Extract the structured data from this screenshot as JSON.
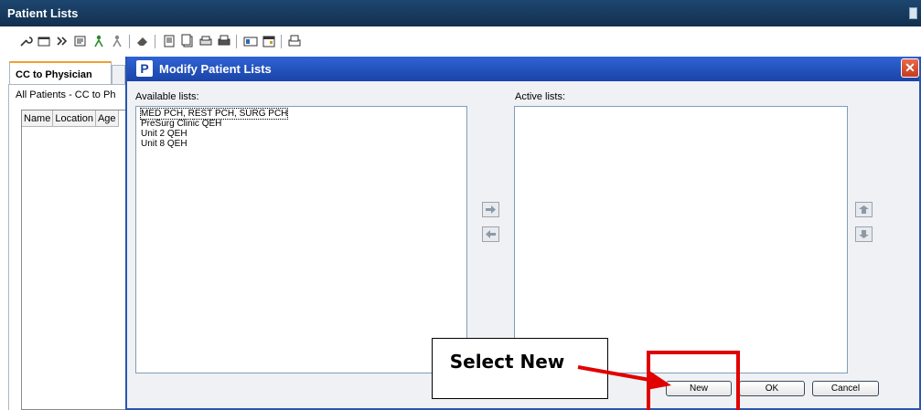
{
  "app": {
    "title": "Patient Lists"
  },
  "toolbar": {
    "icons": [
      "wrench-icon",
      "properties-icon",
      "forward-icon",
      "list-icon",
      "person-add-icon",
      "person-remove-icon",
      "eraser-icon",
      "document-icon",
      "document-copy-icon",
      "print-preview-icon",
      "print-multi-icon",
      "card-icon",
      "calendar-icon",
      "print-icon"
    ]
  },
  "left_panel": {
    "tab_label": "CC to Physician",
    "list_name": "All Patients - CC to Ph",
    "columns": [
      "Name",
      "Location",
      "Age"
    ]
  },
  "dialog": {
    "title": "Modify Patient Lists",
    "title_icon": "P",
    "close": "✕",
    "available_label": "Available lists:",
    "active_label": "Active lists:",
    "available_items": [
      "MED PCH, REST PCH, SURG PCH",
      "PreSurg Clinic QEH",
      "Unit 2 QEH",
      "Unit 8 QEH"
    ],
    "active_items": [],
    "buttons": {
      "new": "New",
      "ok": "OK",
      "cancel": "Cancel"
    }
  },
  "annotation": {
    "text": "Select New",
    "color": "#e00000"
  }
}
